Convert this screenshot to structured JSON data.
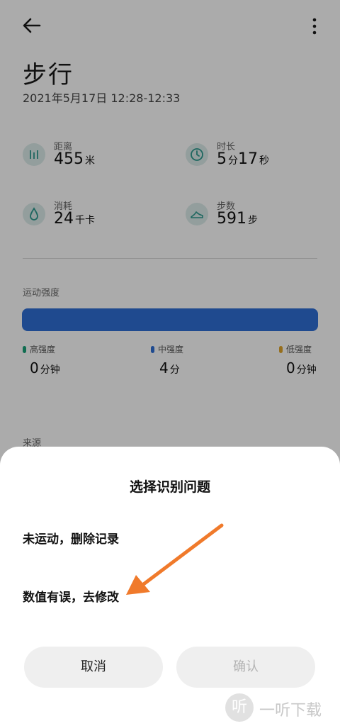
{
  "header": {
    "title": "步行",
    "date": "2021年5月17日 12:28-12:33"
  },
  "stats": [
    {
      "label": "距离",
      "value": "455",
      "unit": "米",
      "icon": "ruler-icon"
    },
    {
      "label": "时长",
      "value": "5",
      "unit": "分",
      "value2": "17",
      "unit2": "秒",
      "icon": "clock-icon"
    },
    {
      "label": "消耗",
      "value": "24",
      "unit": "千卡",
      "icon": "drop-icon"
    },
    {
      "label": "步数",
      "value": "591",
      "unit": "步",
      "icon": "shoe-icon"
    }
  ],
  "intensity": {
    "label": "运动强度",
    "bar_color": "#2f6fd6",
    "items": [
      {
        "label": "高强度",
        "value": "0",
        "unit": "分钟",
        "color": "#1aa37a"
      },
      {
        "label": "中强度",
        "value": "4",
        "unit": "分",
        "color": "#2f6fd6"
      },
      {
        "label": "低强度",
        "value": "0",
        "unit": "分钟",
        "color": "#e0a52a"
      }
    ]
  },
  "source_label": "来源",
  "sheet": {
    "title": "选择识别问题",
    "options": [
      "未运动，删除记录",
      "数值有误，去修改"
    ],
    "cancel_label": "取消",
    "confirm_label": "确认"
  },
  "watermark": {
    "icon_char": "听",
    "text": "一听下载"
  },
  "colors": {
    "accent": "#2f6fd6",
    "icon_teal": "#2e9a8f",
    "annotation_arrow": "#f07a2b"
  }
}
